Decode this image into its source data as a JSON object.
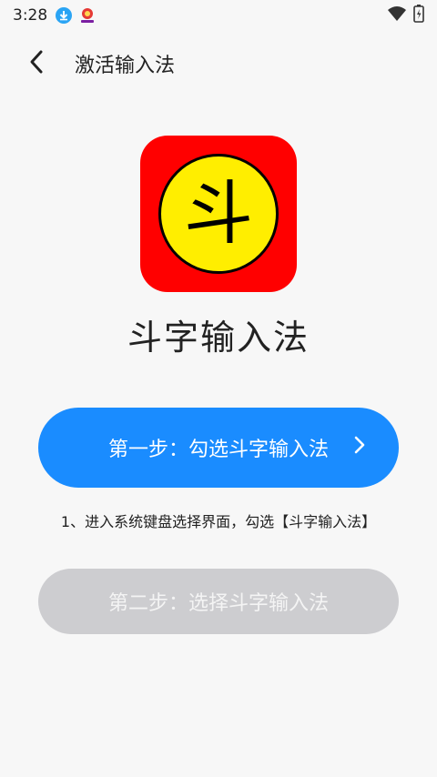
{
  "status_bar": {
    "time": "3:28"
  },
  "header": {
    "title": "激活输入法"
  },
  "app": {
    "icon_glyph": "斗",
    "name": "斗字输入法"
  },
  "step1": {
    "label": "第一步：勾选斗字输入法"
  },
  "hint": {
    "text": "1、进入系统键盘选择界面，勾选【斗字输入法】"
  },
  "step2": {
    "label": "第二步：选择斗字输入法"
  },
  "colors": {
    "primary": "#1a8cff",
    "disabled": "#cdcdd0",
    "icon_bg": "#ff0000",
    "icon_circle": "#ffee00"
  }
}
